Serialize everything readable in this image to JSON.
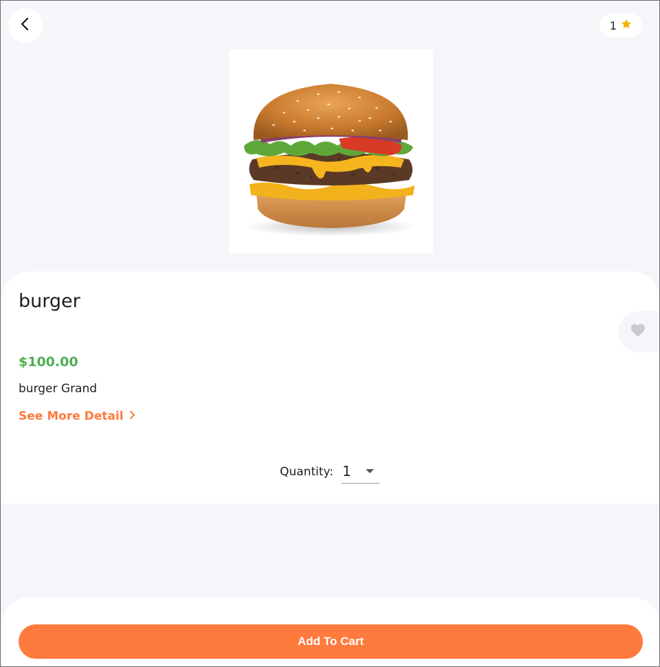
{
  "header": {
    "back_icon": "chevron-left-icon",
    "cart_count": "1",
    "rating_icon": "star-icon",
    "star_color": "#f5b301"
  },
  "product": {
    "name": "burger",
    "price": "$100.00",
    "description": "burger Grand",
    "see_more_label": "See More Detail",
    "favorite_icon": "heart-icon",
    "image_icon": "burger-image"
  },
  "quantity": {
    "label": "Quantity:",
    "selected": "1"
  },
  "actions": {
    "add_to_cart_label": "Add To Cart"
  },
  "colors": {
    "accent": "#ff7a3d",
    "price": "#4caf50",
    "background": "#f4f6f9"
  }
}
